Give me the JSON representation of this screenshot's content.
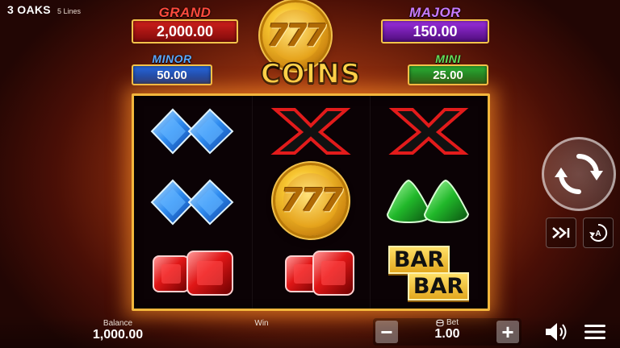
{
  "header": {
    "brand": "3 OAKS",
    "lines": "5 Lines"
  },
  "jackpots": {
    "grand": {
      "label": "GRAND",
      "value": "2,000.00",
      "color": "#d11f1b"
    },
    "major": {
      "label": "MAJOR",
      "value": "150.00",
      "color": "#9b2ee0"
    },
    "minor": {
      "label": "MINOR",
      "value": "50.00",
      "color": "#2a6be0"
    },
    "mini": {
      "label": "MINI",
      "value": "25.00",
      "color": "#2fb336"
    }
  },
  "logo": {
    "coin_text": "777",
    "title": "COINS"
  },
  "reels": [
    [
      "blue-diamond-pair",
      "blue-diamond-pair",
      "red-ruby-pair"
    ],
    [
      "red-x",
      "coin-777",
      "red-ruby-pair"
    ],
    [
      "red-x",
      "green-emerald-pair",
      "bar-bar"
    ]
  ],
  "symbols": {
    "coin_text": "777",
    "bar_label": "BAR"
  },
  "footer": {
    "balance_label": "Balance",
    "balance_value": "1,000.00",
    "win_label": "Win",
    "bet_label": "Bet",
    "bet_value": "1.00",
    "minus": "−",
    "plus": "+"
  },
  "icons": [
    "spin-icon",
    "turbo-icon",
    "autoplay-icon",
    "sound-icon",
    "menu-icon",
    "coin-stack-icon"
  ],
  "colors": {
    "frame": "#f3b63c",
    "accent": "#ffd34a"
  }
}
